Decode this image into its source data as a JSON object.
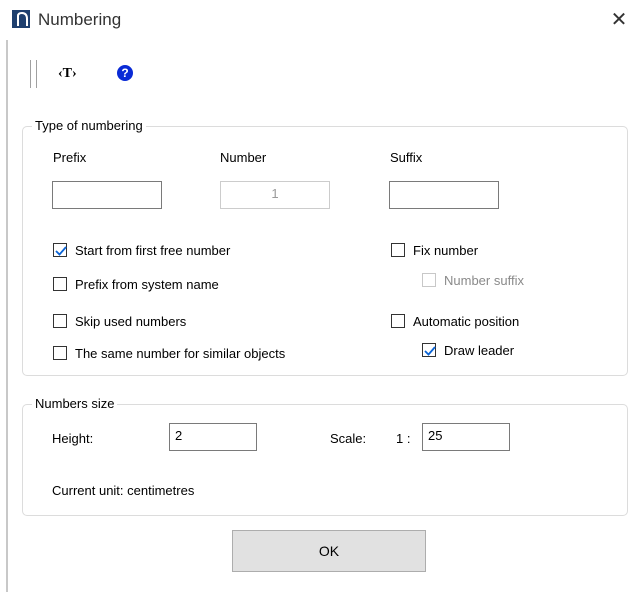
{
  "window": {
    "title": "Numbering",
    "close_icon": "close-icon"
  },
  "toolbar": {
    "text_button": "‹T›",
    "help_button": "?"
  },
  "type_group": {
    "legend": "Type of numbering",
    "prefix_label": "Prefix",
    "number_label": "Number",
    "suffix_label": "Suffix",
    "prefix_value": "",
    "number_value": "1",
    "suffix_value": "",
    "checks": {
      "start_first_free": {
        "label": "Start from first free number",
        "checked": true,
        "enabled": true
      },
      "prefix_system_name": {
        "label": "Prefix from system name",
        "checked": false,
        "enabled": true
      },
      "skip_used": {
        "label": "Skip used numbers",
        "checked": false,
        "enabled": true
      },
      "same_number": {
        "label": "The same number for similar objects",
        "checked": false,
        "enabled": true
      },
      "fix_number": {
        "label": "Fix number",
        "checked": false,
        "enabled": true
      },
      "number_suffix": {
        "label": "Number suffix",
        "checked": false,
        "enabled": false
      },
      "automatic_position": {
        "label": "Automatic position",
        "checked": false,
        "enabled": true
      },
      "draw_leader": {
        "label": "Draw leader",
        "checked": true,
        "enabled": true
      }
    }
  },
  "size_group": {
    "legend": "Numbers size",
    "height_label": "Height:",
    "height_value": "2",
    "scale_label": "Scale:",
    "scale_ratio": "1 :",
    "scale_value": "25",
    "current_unit": "Current unit: centimetres"
  },
  "ok_label": "OK",
  "colors": {
    "check_accent": "#0a64d6",
    "help_blue": "#0a2bd6",
    "icon_navy": "#1e3f6e"
  }
}
